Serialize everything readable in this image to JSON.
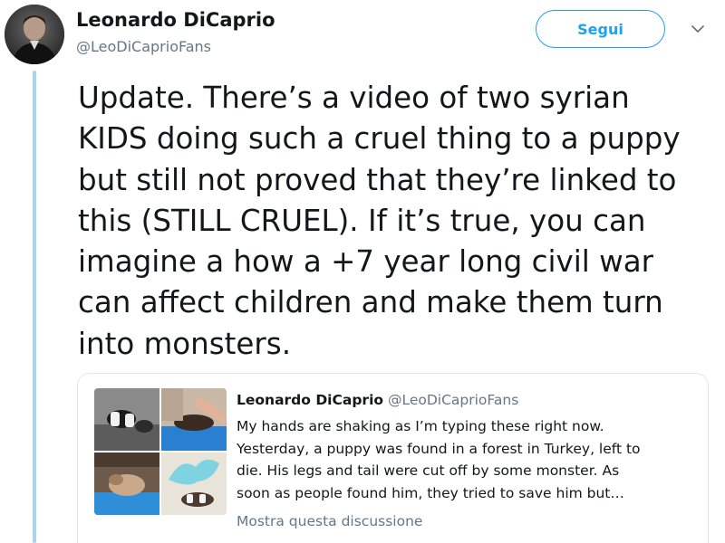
{
  "tweet": {
    "author": {
      "name": "Leonardo DiCaprio",
      "handle": "@LeoDiCaprioFans"
    },
    "follow_label": "Segui",
    "text_lines": [
      "Update. There’s a video of two syrian",
      "KIDS doing such a cruel thing to a puppy",
      "but still not proved that they’re linked to",
      "this (STILL CRUEL). If it’s true, you can",
      "imagine a how a +7 year long civil war",
      "can affect children and make them turn",
      "into monsters."
    ]
  },
  "quoted_tweet": {
    "author_name": "Leonardo DiCaprio",
    "author_handle": "@LeoDiCaprioFans",
    "text_lines": [
      "My hands are shaking as I’m typing these right now.",
      "Yesterday, a puppy was found in a forest in Turkey, left to",
      "die. His legs and tail were cut off by some monster. As",
      "soon as people found him, they tried to save him but…"
    ],
    "show_thread_label": "Mostra questa discussione"
  },
  "colors": {
    "accent": "#1da1f2",
    "thread_line": "#a9d4ec",
    "secondary_text": "#657786",
    "border": "#e1e8ed"
  },
  "icons": {
    "caret": "chevron-down-icon"
  }
}
